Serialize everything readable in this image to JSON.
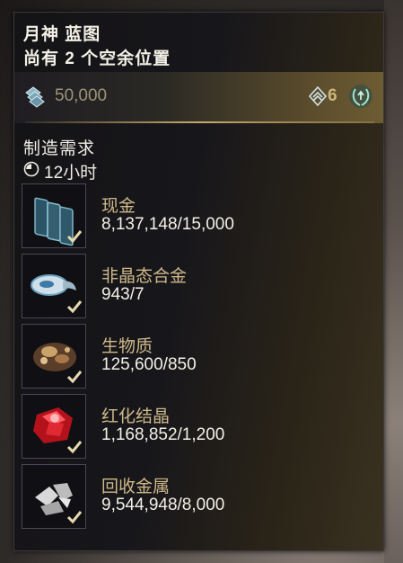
{
  "header": {
    "title": "月神 蓝图",
    "subtitle": "尚有 2 个空余位置"
  },
  "cost": {
    "credits_icon": "credits-icon",
    "credits": "50,000",
    "mastery_icon": "mastery-rank-icon",
    "mastery_rank": "6",
    "laurel_icon": "laurel-icon"
  },
  "requirements": {
    "title": "制造需求",
    "clock_icon": "clock-icon",
    "time": "12小时",
    "items": [
      {
        "name": "现金",
        "count": "8,137,148/15,000",
        "icon": "credits-stack-icon",
        "met": true
      },
      {
        "name": "非晶态合金",
        "count": "943/7",
        "icon": "alloy-icon",
        "met": true
      },
      {
        "name": "生物质",
        "count": "125,600/850",
        "icon": "biomass-icon",
        "met": true
      },
      {
        "name": "红化结晶",
        "count": "1,168,852/1,200",
        "icon": "crystal-icon",
        "met": true
      },
      {
        "name": "回收金属",
        "count": "9,544,948/8,000",
        "icon": "salvage-icon",
        "met": true
      }
    ]
  },
  "colors": {
    "title": "#f3f0e6",
    "item_name": "#cdb98a",
    "accent_gold": "#c6a96b",
    "check": "#e6d9b0"
  }
}
